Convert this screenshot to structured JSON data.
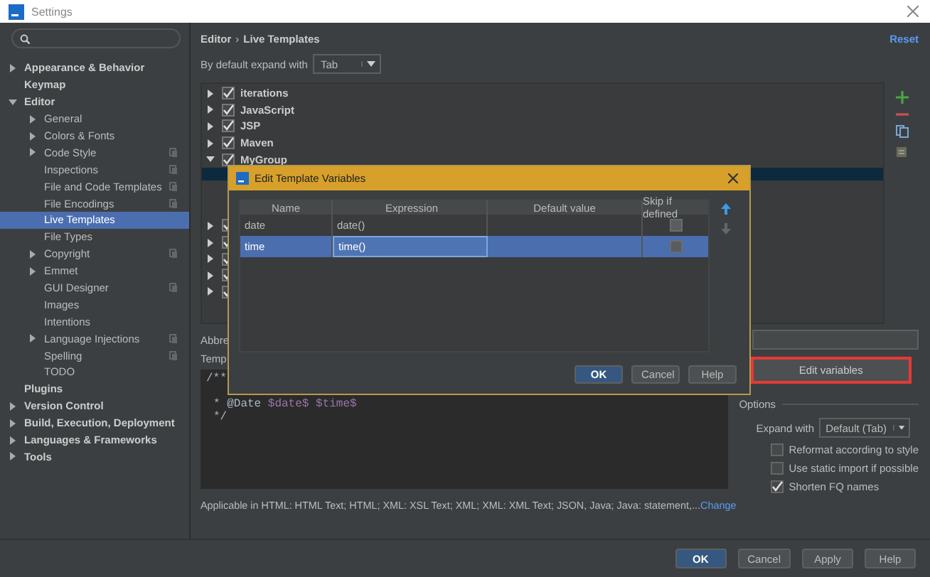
{
  "window": {
    "title": "Settings"
  },
  "sidebar": {
    "items": [
      {
        "label": "Appearance & Behavior",
        "expanded": false,
        "selected": false,
        "shared": false
      },
      {
        "label": "Keymap",
        "selected": false,
        "shared": false
      },
      {
        "label": "Editor",
        "expanded": true,
        "selected": false,
        "shared": false,
        "children": [
          {
            "label": "General",
            "expanded": false,
            "selected": false,
            "shared": false
          },
          {
            "label": "Colors & Fonts",
            "expanded": false,
            "selected": false,
            "shared": false
          },
          {
            "label": "Code Style",
            "expanded": false,
            "selected": false,
            "shared": true
          },
          {
            "label": "Inspections",
            "selected": false,
            "shared": true
          },
          {
            "label": "File and Code Templates",
            "selected": false,
            "shared": true
          },
          {
            "label": "File Encodings",
            "selected": false,
            "shared": true
          },
          {
            "label": "Live Templates",
            "selected": true,
            "shared": false
          },
          {
            "label": "File Types",
            "selected": false,
            "shared": false
          },
          {
            "label": "Copyright",
            "expanded": false,
            "selected": false,
            "shared": true
          },
          {
            "label": "Emmet",
            "expanded": false,
            "selected": false,
            "shared": false
          },
          {
            "label": "GUI Designer",
            "selected": false,
            "shared": true
          },
          {
            "label": "Images",
            "selected": false,
            "shared": false
          },
          {
            "label": "Intentions",
            "selected": false,
            "shared": false
          },
          {
            "label": "Language Injections",
            "expanded": false,
            "selected": false,
            "shared": true
          },
          {
            "label": "Spelling",
            "selected": false,
            "shared": true
          },
          {
            "label": "TODO",
            "selected": false,
            "shared": false
          }
        ]
      },
      {
        "label": "Plugins",
        "selected": false,
        "shared": false
      },
      {
        "label": "Version Control",
        "expanded": false,
        "selected": false,
        "shared": false
      },
      {
        "label": "Build, Execution, Deployment",
        "expanded": false,
        "selected": false,
        "shared": false
      },
      {
        "label": "Languages & Frameworks",
        "expanded": false,
        "selected": false,
        "shared": false
      },
      {
        "label": "Tools",
        "expanded": false,
        "selected": false,
        "shared": false
      }
    ]
  },
  "breadcrumb": {
    "items": [
      "Editor",
      "Live Templates"
    ],
    "separator": "›"
  },
  "reset_link": "Reset",
  "expand_default": {
    "label": "By default expand with",
    "value": "Tab"
  },
  "template_groups": [
    {
      "name": "iterations",
      "checked": true,
      "expanded": false
    },
    {
      "name": "JavaScript",
      "checked": true,
      "expanded": false
    },
    {
      "name": "JSP",
      "checked": true,
      "expanded": false
    },
    {
      "name": "Maven",
      "checked": true,
      "expanded": false
    },
    {
      "name": "MyGroup",
      "checked": true,
      "expanded": true,
      "children": [
        {
          "selected": true
        },
        {
          "selected": false
        },
        {
          "selected": false
        }
      ]
    },
    {
      "checked": true,
      "expanded": false
    },
    {
      "checked": true,
      "expanded": false
    },
    {
      "checked": true,
      "expanded": false
    },
    {
      "checked": true,
      "expanded": false
    },
    {
      "checked": true,
      "expanded": false
    }
  ],
  "abbreviation_label": "Abbre",
  "template_text_label": "Temp",
  "template_text": [
    [
      {
        "kind": "plain",
        "text": "/**"
      }
    ],
    [
      {
        "kind": "plain",
        "text": "* @Date"
      },
      {
        "kind": "variable",
        "text": "$date$"
      },
      {
        "kind": "variable",
        "text": "$time$"
      }
    ],
    [
      {
        "kind": "plain",
        "text": "*/"
      }
    ]
  ],
  "applicable": {
    "text": "Applicable in HTML: HTML Text; HTML; XML: XSL Text; XML; XML: XML Text; JSON, Java; Java: statement,...",
    "link": "Change"
  },
  "edit_variables_button": {
    "label": "Edit variables",
    "highlighted": true
  },
  "options": {
    "title": "Options",
    "expand_with": {
      "label": "Expand with",
      "value": "Default (Tab)"
    },
    "checkboxes": [
      {
        "label": "Reformat according to style",
        "checked": false
      },
      {
        "label": "Use static import if possible",
        "checked": false
      },
      {
        "label": "Shorten FQ names",
        "checked": true
      }
    ]
  },
  "dialog": {
    "title": "Edit Template Variables",
    "columns": [
      "Name",
      "Expression",
      "Default value",
      "Skip if defined"
    ],
    "rows": [
      {
        "name": "date",
        "expression": "date()",
        "skip_if_defined": false,
        "selected": false
      },
      {
        "name": "time",
        "expression": "time()",
        "skip_if_defined": false,
        "selected": true
      }
    ],
    "buttons": [
      {
        "label": "OK",
        "default": true
      },
      {
        "label": "Cancel",
        "default": false
      },
      {
        "label": "Help",
        "default": false
      }
    ]
  },
  "footer_buttons": [
    {
      "label": "OK",
      "default": true
    },
    {
      "label": "Cancel",
      "default": false
    },
    {
      "label": "Apply",
      "default": false
    },
    {
      "label": "Help",
      "default": false
    }
  ]
}
